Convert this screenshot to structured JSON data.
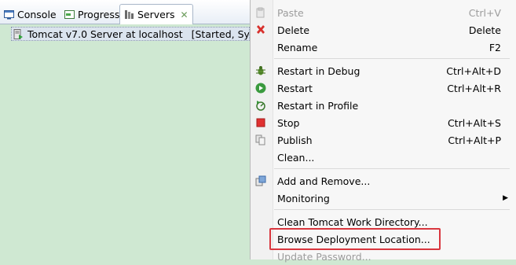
{
  "tabs": [
    {
      "label": "Console",
      "icon": "console-icon"
    },
    {
      "label": "Progress",
      "icon": "progress-icon"
    },
    {
      "label": "Servers",
      "icon": "servers-icon",
      "active": true
    }
  ],
  "servers": [
    {
      "name": "Tomcat v7.0 Server at localhost",
      "status": "[Started, Synchr"
    }
  ],
  "menu": {
    "items": [
      {
        "label": "Paste",
        "accel": "Ctrl+V",
        "disabled": true,
        "icon": "paste-icon"
      },
      {
        "label": "Delete",
        "accel": "Delete",
        "icon": "delete-icon"
      },
      {
        "label": "Rename",
        "accel": "F2"
      },
      {
        "label": "Restart in Debug",
        "accel": "Ctrl+Alt+D",
        "icon": "debug-icon"
      },
      {
        "label": "Restart",
        "accel": "Ctrl+Alt+R",
        "icon": "run-icon"
      },
      {
        "label": "Restart in Profile",
        "accel": "",
        "icon": "profile-icon"
      },
      {
        "label": "Stop",
        "accel": "Ctrl+Alt+S",
        "icon": "stop-icon"
      },
      {
        "label": "Publish",
        "accel": "Ctrl+Alt+P",
        "icon": "publish-icon"
      },
      {
        "label": "Clean...",
        "accel": ""
      },
      {
        "label": "Add and Remove...",
        "accel": "",
        "icon": "add-remove-icon"
      },
      {
        "label": "Monitoring",
        "accel": "",
        "submenu": true
      },
      {
        "label": "Clean Tomcat Work Directory...",
        "accel": ""
      },
      {
        "label": "Browse Deployment Location...",
        "accel": "",
        "highlighted": true
      },
      {
        "label": "Update Password...",
        "accel": "",
        "disabled": true
      }
    ]
  },
  "colors": {
    "highlight_border": "#d9363e",
    "view_background": "#cfe8d2",
    "delete_red": "#d8302c",
    "run_green": "#3a9a3e",
    "stop_red": "#e03131"
  }
}
